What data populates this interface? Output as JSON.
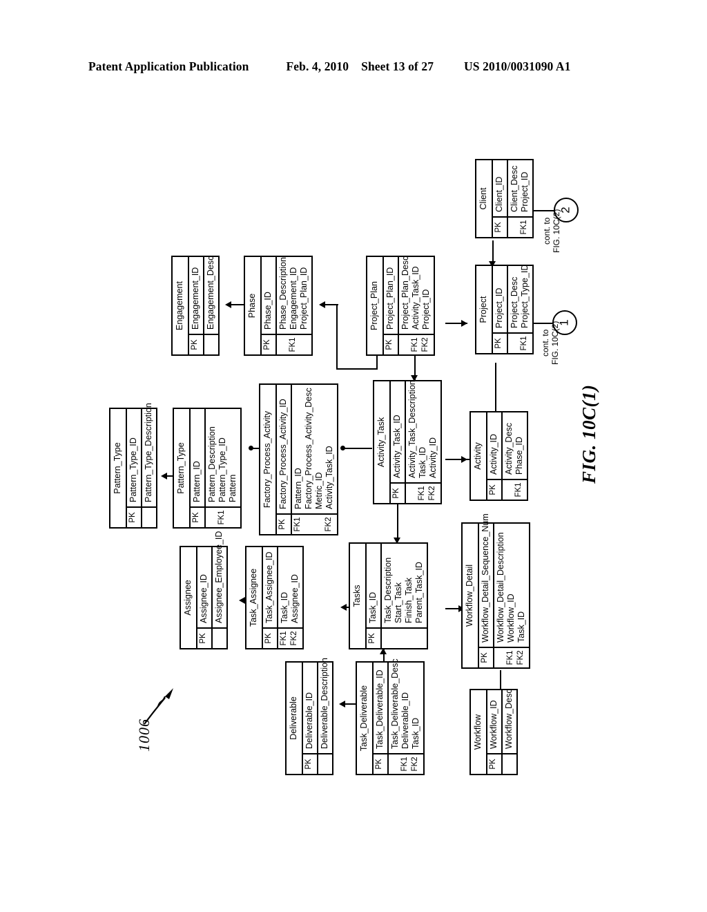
{
  "header": {
    "title": "Patent Application Publication",
    "date": "Feb. 4, 2010",
    "sheet": "Sheet 13 of 27",
    "pub_number": "US 2010/0031090 A1"
  },
  "figure": {
    "caption": "FIG. 10C(1)",
    "reference_numeral": "1006"
  },
  "connectors": [
    {
      "id": "conn-1",
      "number": "1",
      "label_line1": "cont. to",
      "label_line2": "FIG. 10C(2)"
    },
    {
      "id": "conn-2",
      "number": "2",
      "label_line1": "cont. to",
      "label_line2": "FIG. 10C(2)"
    }
  ],
  "entities": [
    {
      "id": "client",
      "name": "Client",
      "sections": [
        {
          "keys": [
            "PK"
          ],
          "fields": [
            "Client_ID"
          ]
        },
        {
          "keys": [
            "",
            "FK1"
          ],
          "fields": [
            "Client_Desc",
            "Project_ID"
          ]
        }
      ]
    },
    {
      "id": "engagement",
      "name": "Engagement",
      "sections": [
        {
          "keys": [
            "PK"
          ],
          "fields": [
            "Engagement_ID"
          ]
        },
        {
          "keys": [
            ""
          ],
          "fields": [
            "Engagement_Desc"
          ]
        }
      ]
    },
    {
      "id": "phase",
      "name": "Phase",
      "sections": [
        {
          "keys": [
            "PK"
          ],
          "fields": [
            "Phase_ID"
          ]
        },
        {
          "keys": [
            "",
            "FK1",
            ""
          ],
          "fields": [
            "Phase_Description",
            "Engagement_ID",
            "Project_Plan_ID"
          ]
        }
      ]
    },
    {
      "id": "project_plan",
      "name": "Project_Plan",
      "sections": [
        {
          "keys": [
            "PK"
          ],
          "fields": [
            "Project_Plan_ID"
          ]
        },
        {
          "keys": [
            "",
            "FK1",
            "FK2"
          ],
          "fields": [
            "Project_Plan_Desc",
            "Activity_Task_ID",
            "Project_ID"
          ]
        }
      ]
    },
    {
      "id": "project",
      "name": "Project",
      "sections": [
        {
          "keys": [
            "PK"
          ],
          "fields": [
            "Project_ID"
          ]
        },
        {
          "keys": [
            "",
            "FK1"
          ],
          "fields": [
            "Project_Desc",
            "Project_Type_ID"
          ]
        }
      ]
    },
    {
      "id": "pattern_type",
      "name": "Pattern_Type",
      "sections": [
        {
          "keys": [
            "PK"
          ],
          "fields": [
            "Pattern_Type_ID"
          ]
        },
        {
          "keys": [
            ""
          ],
          "fields": [
            "Pattern_Type_Description"
          ]
        }
      ]
    },
    {
      "id": "pattern",
      "name": "Pattern_Type",
      "sections": [
        {
          "keys": [
            "PK"
          ],
          "fields": [
            "Pattern_ID"
          ]
        },
        {
          "keys": [
            "",
            "FK1",
            ""
          ],
          "fields": [
            "Pattern_Description",
            "Pattern_Type_ID",
            "Pattern"
          ]
        }
      ]
    },
    {
      "id": "factory_process_activity",
      "name": "Factory_Process_Activity",
      "sections": [
        {
          "keys": [
            "PK"
          ],
          "fields": [
            "Factory_Process_Activity_ID"
          ]
        },
        {
          "keys": [
            "FK1",
            "",
            "",
            "FK2"
          ],
          "fields": [
            "Pattern_ID",
            "Factory_Process_Activity_Desc",
            "Metric_ID",
            "Activity_Task_ID"
          ]
        }
      ]
    },
    {
      "id": "activity_task",
      "name": "Activity_Task",
      "sections": [
        {
          "keys": [
            "PK"
          ],
          "fields": [
            "Activity_Task_ID"
          ]
        },
        {
          "keys": [
            "",
            "FK1",
            "FK2"
          ],
          "fields": [
            "Activity_Task_Description",
            "Task_ID",
            "Activity_ID"
          ]
        }
      ]
    },
    {
      "id": "activity",
      "name": "Activity",
      "sections": [
        {
          "keys": [
            "PK"
          ],
          "fields": [
            "Activity_ID"
          ]
        },
        {
          "keys": [
            "",
            "FK1"
          ],
          "fields": [
            "Activity_Desc",
            "Phase_ID"
          ]
        }
      ]
    },
    {
      "id": "assignee",
      "name": "Assignee",
      "sections": [
        {
          "keys": [
            "PK"
          ],
          "fields": [
            "Assignee_ID"
          ]
        },
        {
          "keys": [
            ""
          ],
          "fields": [
            "Assignee_Employee_ID"
          ]
        }
      ]
    },
    {
      "id": "task_assignee",
      "name": "Task_Assignee",
      "sections": [
        {
          "keys": [
            "PK"
          ],
          "fields": [
            "Task_Assignee_ID"
          ]
        },
        {
          "keys": [
            "FK1",
            "FK2"
          ],
          "fields": [
            "Task_ID",
            "Assignee_ID"
          ]
        }
      ]
    },
    {
      "id": "tasks",
      "name": "Tasks",
      "sections": [
        {
          "keys": [
            "PK"
          ],
          "fields": [
            "Task_ID"
          ]
        },
        {
          "keys": [
            "",
            "",
            "",
            ""
          ],
          "fields": [
            "Task_Description",
            "Start_Task",
            "Finish_Task",
            "Parent_Task_ID"
          ]
        }
      ]
    },
    {
      "id": "workflow_detail",
      "name": "Workflow_Detail",
      "sections": [
        {
          "keys": [
            "PK"
          ],
          "fields": [
            "Workflow_Detail_Sequence_Num"
          ]
        },
        {
          "keys": [
            "",
            "FK1",
            "FK2"
          ],
          "fields": [
            "Workflow_Detail_Description",
            "Workflow_ID",
            "Task_ID"
          ]
        }
      ]
    },
    {
      "id": "deliverable",
      "name": "Deliverable",
      "sections": [
        {
          "keys": [
            "PK"
          ],
          "fields": [
            "Deliverable_ID"
          ]
        },
        {
          "keys": [
            ""
          ],
          "fields": [
            "Deliverable_Description"
          ]
        }
      ]
    },
    {
      "id": "task_deliverable",
      "name": "Task_Deliverable",
      "sections": [
        {
          "keys": [
            "PK"
          ],
          "fields": [
            "Task_Deliverable_ID"
          ]
        },
        {
          "keys": [
            "",
            "FK1",
            "FK2"
          ],
          "fields": [
            "Task_Deliverable_Desc",
            "Deliverable_ID",
            "Task_ID"
          ]
        }
      ]
    },
    {
      "id": "workflow",
      "name": "Workflow",
      "sections": [
        {
          "keys": [
            "PK"
          ],
          "fields": [
            "Workflow_ID"
          ]
        },
        {
          "keys": [
            ""
          ],
          "fields": [
            "Workflow_Desc"
          ]
        }
      ]
    }
  ]
}
